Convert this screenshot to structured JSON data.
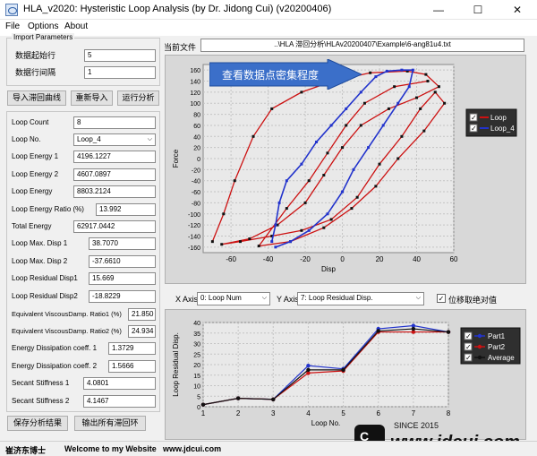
{
  "window": {
    "title": "HLA_v2020: Hysteristic Loop Analysis  (by Dr. Jidong Cui) (v20200406)",
    "minimize": "—",
    "maximize": "☐",
    "close": "✕"
  },
  "menu": [
    "File",
    "Options",
    "About"
  ],
  "import": {
    "group_title": "Import Parameters",
    "start_row_label": "数据起始行",
    "start_row_value": "5",
    "interval_label": "数据行间隔",
    "interval_value": "1"
  },
  "buttons": {
    "import_curve": "导入滞回曲线",
    "reimport": "重新导入",
    "run_analysis": "运行分析",
    "save_results": "保存分析结果",
    "export_loops": "输出所有滞回环"
  },
  "current_file": {
    "label": "当前文件",
    "path": "..\\HLA 滞回分析\\HLAv20200407\\Example\\6-ang81u4.txt"
  },
  "results": [
    {
      "label": "Loop Count",
      "value": "8"
    },
    {
      "label": "Loop No.",
      "value": "Loop_4"
    },
    {
      "label": "Loop Energy 1",
      "value": "4196.1227"
    },
    {
      "label": "Loop Energy 2",
      "value": "4607.0897"
    },
    {
      "label": "Loop Energy",
      "value": "8803.2124"
    },
    {
      "label": "Loop Energy Ratio (%)",
      "value": "13.992"
    },
    {
      "label": "Total Energy",
      "value": "62917.0442"
    },
    {
      "label": "Loop Max. Disp 1",
      "value": "38.7070"
    },
    {
      "label": "Loop Max. Disp 2",
      "value": "-37.6610"
    },
    {
      "label": "Loop Residual Disp1",
      "value": "15.669"
    },
    {
      "label": "Loop Residual Disp2",
      "value": "-18.8229"
    },
    {
      "label": "Equivalent ViscousDamp. Ratio1 (%)",
      "value": "21.850"
    },
    {
      "label": "Equivalent ViscousDamp. Ratio2 (%)",
      "value": "24.934"
    },
    {
      "label": "Energy Dissipation coeff. 1",
      "value": "1.3729"
    },
    {
      "label": "Energy Dissipation coeff. 2",
      "value": "1.5666"
    },
    {
      "label": "Secant Stiffness 1",
      "value": "4.0801"
    },
    {
      "label": "Secant Stiffness 2",
      "value": "4.1467"
    }
  ],
  "banner": "查看数据点密集程度",
  "axis_controls": {
    "x_label": "X Axis",
    "x_value": "0: Loop Num",
    "y_label": "Y Axis",
    "y_value": "7: Loop Residual Disp.",
    "abs_label": "位移取绝对值",
    "abs_checked": "✓"
  },
  "status": {
    "author": "崔济东博士",
    "welcome": "Welcome to my Website",
    "site": "www.jdcui.com"
  },
  "watermark": {
    "since": "SINCE 2015",
    "site": "www.jdcui.com"
  },
  "colors": {
    "loop": "#cc1111",
    "loop4": "#2233cc",
    "part1": "#2233cc",
    "part2": "#cc1111",
    "average": "#111111",
    "banner": "#3b6fc9"
  },
  "chart_data": [
    {
      "type": "scatter",
      "title": "",
      "xlabel": "Disp",
      "ylabel": "Force",
      "xlim": [
        -75,
        60
      ],
      "ylim": [
        -170,
        170
      ],
      "x_ticks": [
        -60,
        -40,
        -20,
        0,
        20,
        40,
        60
      ],
      "y_ticks": [
        -160,
        -140,
        -120,
        -100,
        -80,
        -60,
        -40,
        -20,
        0,
        20,
        40,
        60,
        80,
        100,
        120,
        140,
        160
      ],
      "grid": true,
      "legend_position": "right",
      "series": [
        {
          "name": "Loop",
          "points": [
            [
              -70,
              -150
            ],
            [
              -64,
              -100
            ],
            [
              -58,
              -40
            ],
            [
              -48,
              40
            ],
            [
              -38,
              90
            ],
            [
              -22,
              120
            ],
            [
              -5,
              140
            ],
            [
              15,
              155
            ],
            [
              35,
              158
            ],
            [
              45,
              152
            ],
            [
              52,
              130
            ],
            [
              40,
              110
            ],
            [
              25,
              90
            ],
            [
              10,
              60
            ],
            [
              0,
              20
            ],
            [
              -10,
              -30
            ],
            [
              -20,
              -80
            ],
            [
              -35,
              -120
            ],
            [
              -50,
              -145
            ],
            [
              -65,
              -155
            ],
            [
              -55,
              -150
            ],
            [
              -38,
              -140
            ],
            [
              -22,
              -130
            ],
            [
              -6,
              -110
            ],
            [
              8,
              -70
            ],
            [
              20,
              -10
            ],
            [
              32,
              40
            ],
            [
              42,
              90
            ],
            [
              50,
              120
            ],
            [
              55,
              100
            ],
            [
              44,
              50
            ],
            [
              30,
              0
            ],
            [
              18,
              -50
            ],
            [
              5,
              -90
            ],
            [
              -10,
              -125
            ],
            [
              -28,
              -150
            ],
            [
              -45,
              -158
            ],
            [
              -30,
              -90
            ],
            [
              -18,
              -40
            ],
            [
              -8,
              10
            ],
            [
              2,
              60
            ],
            [
              12,
              100
            ],
            [
              28,
              130
            ],
            [
              46,
              140
            ]
          ]
        },
        {
          "name": "Loop_4",
          "points": [
            [
              -38,
              -150
            ],
            [
              -36,
              -120
            ],
            [
              -34,
              -80
            ],
            [
              -30,
              -40
            ],
            [
              -22,
              -10
            ],
            [
              -14,
              30
            ],
            [
              -6,
              60
            ],
            [
              2,
              90
            ],
            [
              10,
              120
            ],
            [
              18,
              148
            ],
            [
              24,
              158
            ],
            [
              32,
              160
            ],
            [
              38,
              160
            ],
            [
              36,
              130
            ],
            [
              30,
              100
            ],
            [
              22,
              60
            ],
            [
              14,
              20
            ],
            [
              6,
              -20
            ],
            [
              0,
              -60
            ],
            [
              -8,
              -100
            ],
            [
              -18,
              -130
            ],
            [
              -28,
              -150
            ],
            [
              -36,
              -160
            ]
          ]
        }
      ]
    },
    {
      "type": "line",
      "title": "",
      "xlabel": "Loop No.",
      "ylabel": "Loop Residual Disp.",
      "x": [
        1,
        2,
        3,
        4,
        5,
        6,
        7,
        8
      ],
      "xlim": [
        1,
        8
      ],
      "ylim": [
        0,
        40
      ],
      "y_ticks": [
        0,
        5,
        10,
        15,
        20,
        25,
        30,
        35,
        40
      ],
      "grid": true,
      "legend_position": "top-right",
      "series": [
        {
          "name": "Part1",
          "values": [
            1.0,
            4.0,
            3.5,
            19.5,
            18.0,
            37.0,
            38.5,
            35.5
          ]
        },
        {
          "name": "Part2",
          "values": [
            1.0,
            4.0,
            3.5,
            16.0,
            17.0,
            35.5,
            35.5,
            35.5
          ]
        },
        {
          "name": "Average",
          "values": [
            1.0,
            4.0,
            3.5,
            17.5,
            17.5,
            36.0,
            37.0,
            35.5
          ]
        }
      ]
    }
  ]
}
